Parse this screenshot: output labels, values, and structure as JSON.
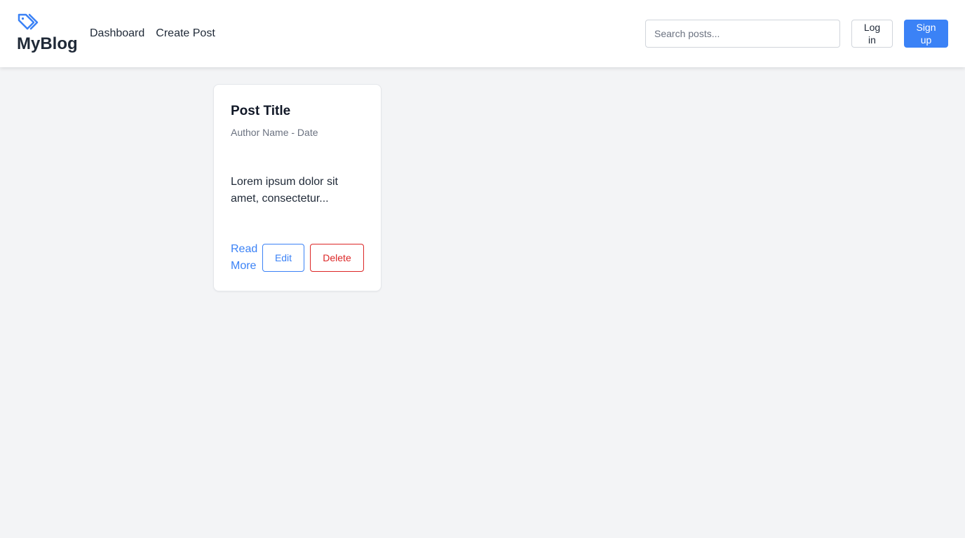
{
  "header": {
    "brand": {
      "icon": "tags-icon",
      "name": "MyBlog"
    },
    "nav": [
      {
        "label": "Dashboard"
      },
      {
        "label": "Create Post"
      }
    ],
    "search": {
      "placeholder": "Search posts...",
      "value": ""
    },
    "login_label": "Log in",
    "signup_label": "Sign up"
  },
  "posts": [
    {
      "title": "Post Title",
      "meta": "Author Name - Date",
      "excerpt": "Lorem ipsum dolor sit amet, consectetur...",
      "read_more_label": "Read More",
      "edit_label": "Edit",
      "delete_label": "Delete"
    }
  ],
  "colors": {
    "accent": "#3b82f6",
    "danger": "#dc2626",
    "background": "#f3f4f6",
    "text": "#1f2937",
    "muted": "#6b7280"
  }
}
